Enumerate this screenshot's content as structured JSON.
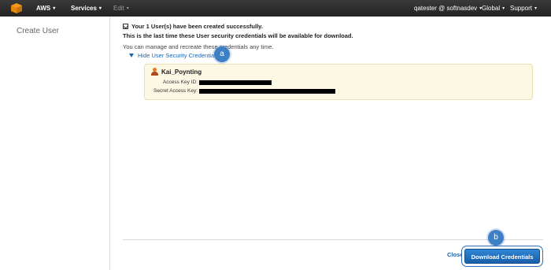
{
  "topbar": {
    "aws_label": "AWS",
    "services_label": "Services",
    "edit_label": "Edit",
    "user_label": "qatester @ softnasdev",
    "region_label": "Global",
    "support_label": "Support"
  },
  "sidebar": {
    "title": "Create User"
  },
  "main": {
    "success_text": "Your 1 User(s) have been created successfully.",
    "last_time_text": "This is the last time these User security credentials will be available for download.",
    "manage_text": "You can manage and recreate these credentials any time.",
    "toggle_label": "Hide User Security Credentials"
  },
  "credentials": {
    "user_name": "Kai_Poynting",
    "access_key_label": "Access Key ID:",
    "secret_key_label": "Secret Access Key:"
  },
  "footer": {
    "close_label": "Close",
    "download_label": "Download Credentials"
  },
  "callouts": {
    "a": "a",
    "b": "b"
  },
  "colors": {
    "topbar": "#232323",
    "link": "#1a66b3",
    "callout": "#3f7fc6",
    "cred_box_bg": "#fcf8e3",
    "primary_button": "#1f6fbd"
  }
}
